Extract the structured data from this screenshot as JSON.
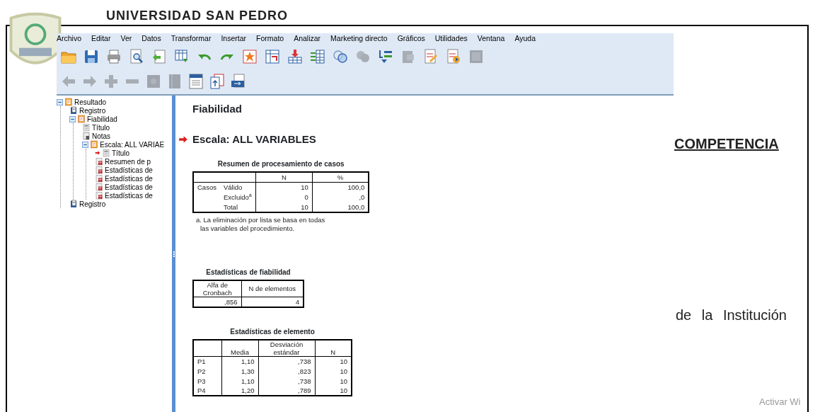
{
  "document": {
    "heading": "UNIVERSIDAD SAN PEDRO",
    "section_title": "COMPETENCIA",
    "body_text": "de la Institución",
    "os_notice": "Activar Wi"
  },
  "window": {
    "menu": [
      "Archivo",
      "Editar",
      "Ver",
      "Datos",
      "Transformar",
      "Insertar",
      "Formato",
      "Analizar",
      "Marketing directo",
      "Gráficos",
      "Utilidades",
      "Ventana",
      "Ayuda"
    ],
    "toolbar_1": [
      {
        "disabled": false
      },
      {
        "disabled": false
      },
      {
        "disabled": false
      },
      {
        "disabled": false
      },
      {
        "disabled": false
      },
      {
        "disabled": false
      },
      {
        "disabled": false
      },
      {
        "disabled": false
      },
      {
        "disabled": false
      },
      {
        "disabled": false
      },
      {
        "disabled": false
      },
      {
        "disabled": false
      },
      {
        "disabled": false
      },
      {
        "disabled": true
      },
      {
        "disabled": false
      },
      {
        "disabled": true
      },
      {
        "disabled": false
      },
      {
        "disabled": false
      },
      {
        "disabled": true
      }
    ],
    "toolbar_2": [
      {
        "disabled": true
      },
      {
        "disabled": true
      },
      {
        "disabled": true
      },
      {
        "disabled": true
      },
      {
        "disabled": true
      },
      {
        "disabled": true
      },
      {
        "disabled": false
      },
      {
        "disabled": false
      },
      {
        "disabled": false
      }
    ]
  },
  "outline": [
    {
      "label": "Resultado",
      "kind": "heading",
      "expanded": true,
      "selected": false,
      "children": [
        {
          "label": "Registro",
          "kind": "log",
          "selected": false
        },
        {
          "label": "Fiabilidad",
          "kind": "heading",
          "expanded": true,
          "selected": false,
          "children": [
            {
              "label": "Título",
              "kind": "title",
              "selected": false
            },
            {
              "label": "Notas",
              "kind": "notes",
              "selected": false
            },
            {
              "label": "Escala: ALL VARIAE",
              "kind": "heading",
              "expanded": true,
              "selected": false,
              "children": [
                {
                  "label": "Título",
                  "kind": "title",
                  "selected": true
                },
                {
                  "label": "Resumen de p",
                  "kind": "table",
                  "selected": false
                },
                {
                  "label": "Estadísticas de",
                  "kind": "table",
                  "selected": false
                },
                {
                  "label": "Estadísticas de",
                  "kind": "table",
                  "selected": false
                },
                {
                  "label": "Estadísticas de",
                  "kind": "table",
                  "selected": false
                },
                {
                  "label": "Estadísticas de",
                  "kind": "table",
                  "selected": false
                }
              ]
            }
          ]
        },
        {
          "label": "Registro",
          "kind": "log",
          "selected": false
        }
      ]
    }
  ],
  "output": {
    "title": "Fiabilidad",
    "subtitle": "Escala: ALL VARIABLES",
    "case_summary": {
      "title": "Resumen de procesamiento de casos",
      "columns": [
        "N",
        "%"
      ],
      "group": "Casos",
      "rows": [
        {
          "label": "Válido",
          "values": [
            "10",
            "100,0"
          ]
        },
        {
          "label": "Excluido$^{a}$",
          "values": [
            "0",
            ",0"
          ]
        },
        {
          "label": "Total",
          "values": [
            "10",
            "100,0"
          ]
        }
      ],
      "footnote": "a. La eliminación por lista se basa en todas las variables del procedimiento."
    },
    "reliability": {
      "title": "Estadísticas de fiabilidad",
      "columns": [
        "Alfa de Cronbach",
        "N de elementos"
      ],
      "rows": [
        [
          ",856",
          "4"
        ]
      ]
    },
    "item_stats": {
      "title": "Estadísticas de elemento",
      "columns": [
        "Media",
        "Desviación estándar",
        "N"
      ],
      "rows": [
        {
          "label": "P1",
          "values": [
            "1,10",
            ",738",
            "10"
          ]
        },
        {
          "label": "P2",
          "values": [
            "1,30",
            ",823",
            "10"
          ]
        },
        {
          "label": "P3",
          "values": [
            "1,10",
            ",738",
            "10"
          ]
        },
        {
          "label": "P4",
          "values": [
            "1,20",
            ",789",
            "10"
          ]
        }
      ]
    }
  }
}
